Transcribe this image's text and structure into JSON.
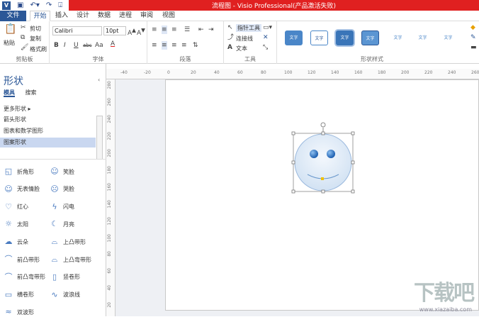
{
  "window": {
    "title": "流程图 - Visio Professional(产品激活失败)"
  },
  "tabs": [
    "文件",
    "开始",
    "插入",
    "设计",
    "数据",
    "进程",
    "审阅",
    "视图"
  ],
  "clipboard": {
    "paste": "粘贴",
    "cut": "剪切",
    "copy": "复制",
    "format_painter": "格式刷",
    "label": "剪贴板"
  },
  "font": {
    "name": "Calibri",
    "size": "10pt",
    "label": "字体",
    "bold": "B",
    "italic": "I",
    "underline": "U",
    "strike": "abc",
    "size_aa": "Aa",
    "color": "A"
  },
  "paragraph": {
    "label": "段落"
  },
  "tools": {
    "pointer": "指针工具",
    "connector": "连接线",
    "text": "文本",
    "label": "工具"
  },
  "shape_styles": {
    "label": "形状样式",
    "sample": "文字"
  },
  "panel": {
    "title": "形状",
    "tab_more": "模具",
    "tab_search": "搜索",
    "more_shapes": "更多形状",
    "stencils": [
      "箭头形状",
      "图表和数学图形",
      "图案形状"
    ],
    "shapes": [
      {
        "label": "折角形",
        "icon": "folded-corner-icon"
      },
      {
        "label": "笑脸",
        "icon": "smiley-icon"
      },
      {
        "label": "无表情脸",
        "icon": "neutral-face-icon"
      },
      {
        "label": "哭脸",
        "icon": "sad-face-icon"
      },
      {
        "label": "红心",
        "icon": "heart-icon"
      },
      {
        "label": "闪电",
        "icon": "lightning-icon"
      },
      {
        "label": "太阳",
        "icon": "sun-icon"
      },
      {
        "label": "月亮",
        "icon": "moon-icon"
      },
      {
        "label": "云朵",
        "icon": "cloud-icon"
      },
      {
        "label": "上凸带形",
        "icon": "ribbon-up-icon"
      },
      {
        "label": "前凸带形",
        "icon": "ribbon-front-icon"
      },
      {
        "label": "上凸弯带形",
        "icon": "curved-ribbon-up-icon"
      },
      {
        "label": "前凸弯带形",
        "icon": "curved-ribbon-front-icon"
      },
      {
        "label": "竖卷形",
        "icon": "vertical-scroll-icon"
      },
      {
        "label": "横卷形",
        "icon": "horizontal-scroll-icon"
      },
      {
        "label": "波浪线",
        "icon": "wave-icon"
      },
      {
        "label": "双波形",
        "icon": "double-wave-icon"
      }
    ]
  },
  "ruler_top": [
    "-40",
    "-20",
    "0",
    "20",
    "40",
    "60",
    "80",
    "100",
    "120",
    "140",
    "160",
    "180",
    "200",
    "220",
    "240",
    "260"
  ],
  "ruler_left": [
    "280",
    "260",
    "240",
    "220",
    "200",
    "180",
    "160",
    "140",
    "120",
    "100",
    "80",
    "60",
    "40",
    "20"
  ],
  "watermark": {
    "logo": "下载吧",
    "url": "www.xiazaiba.com"
  }
}
